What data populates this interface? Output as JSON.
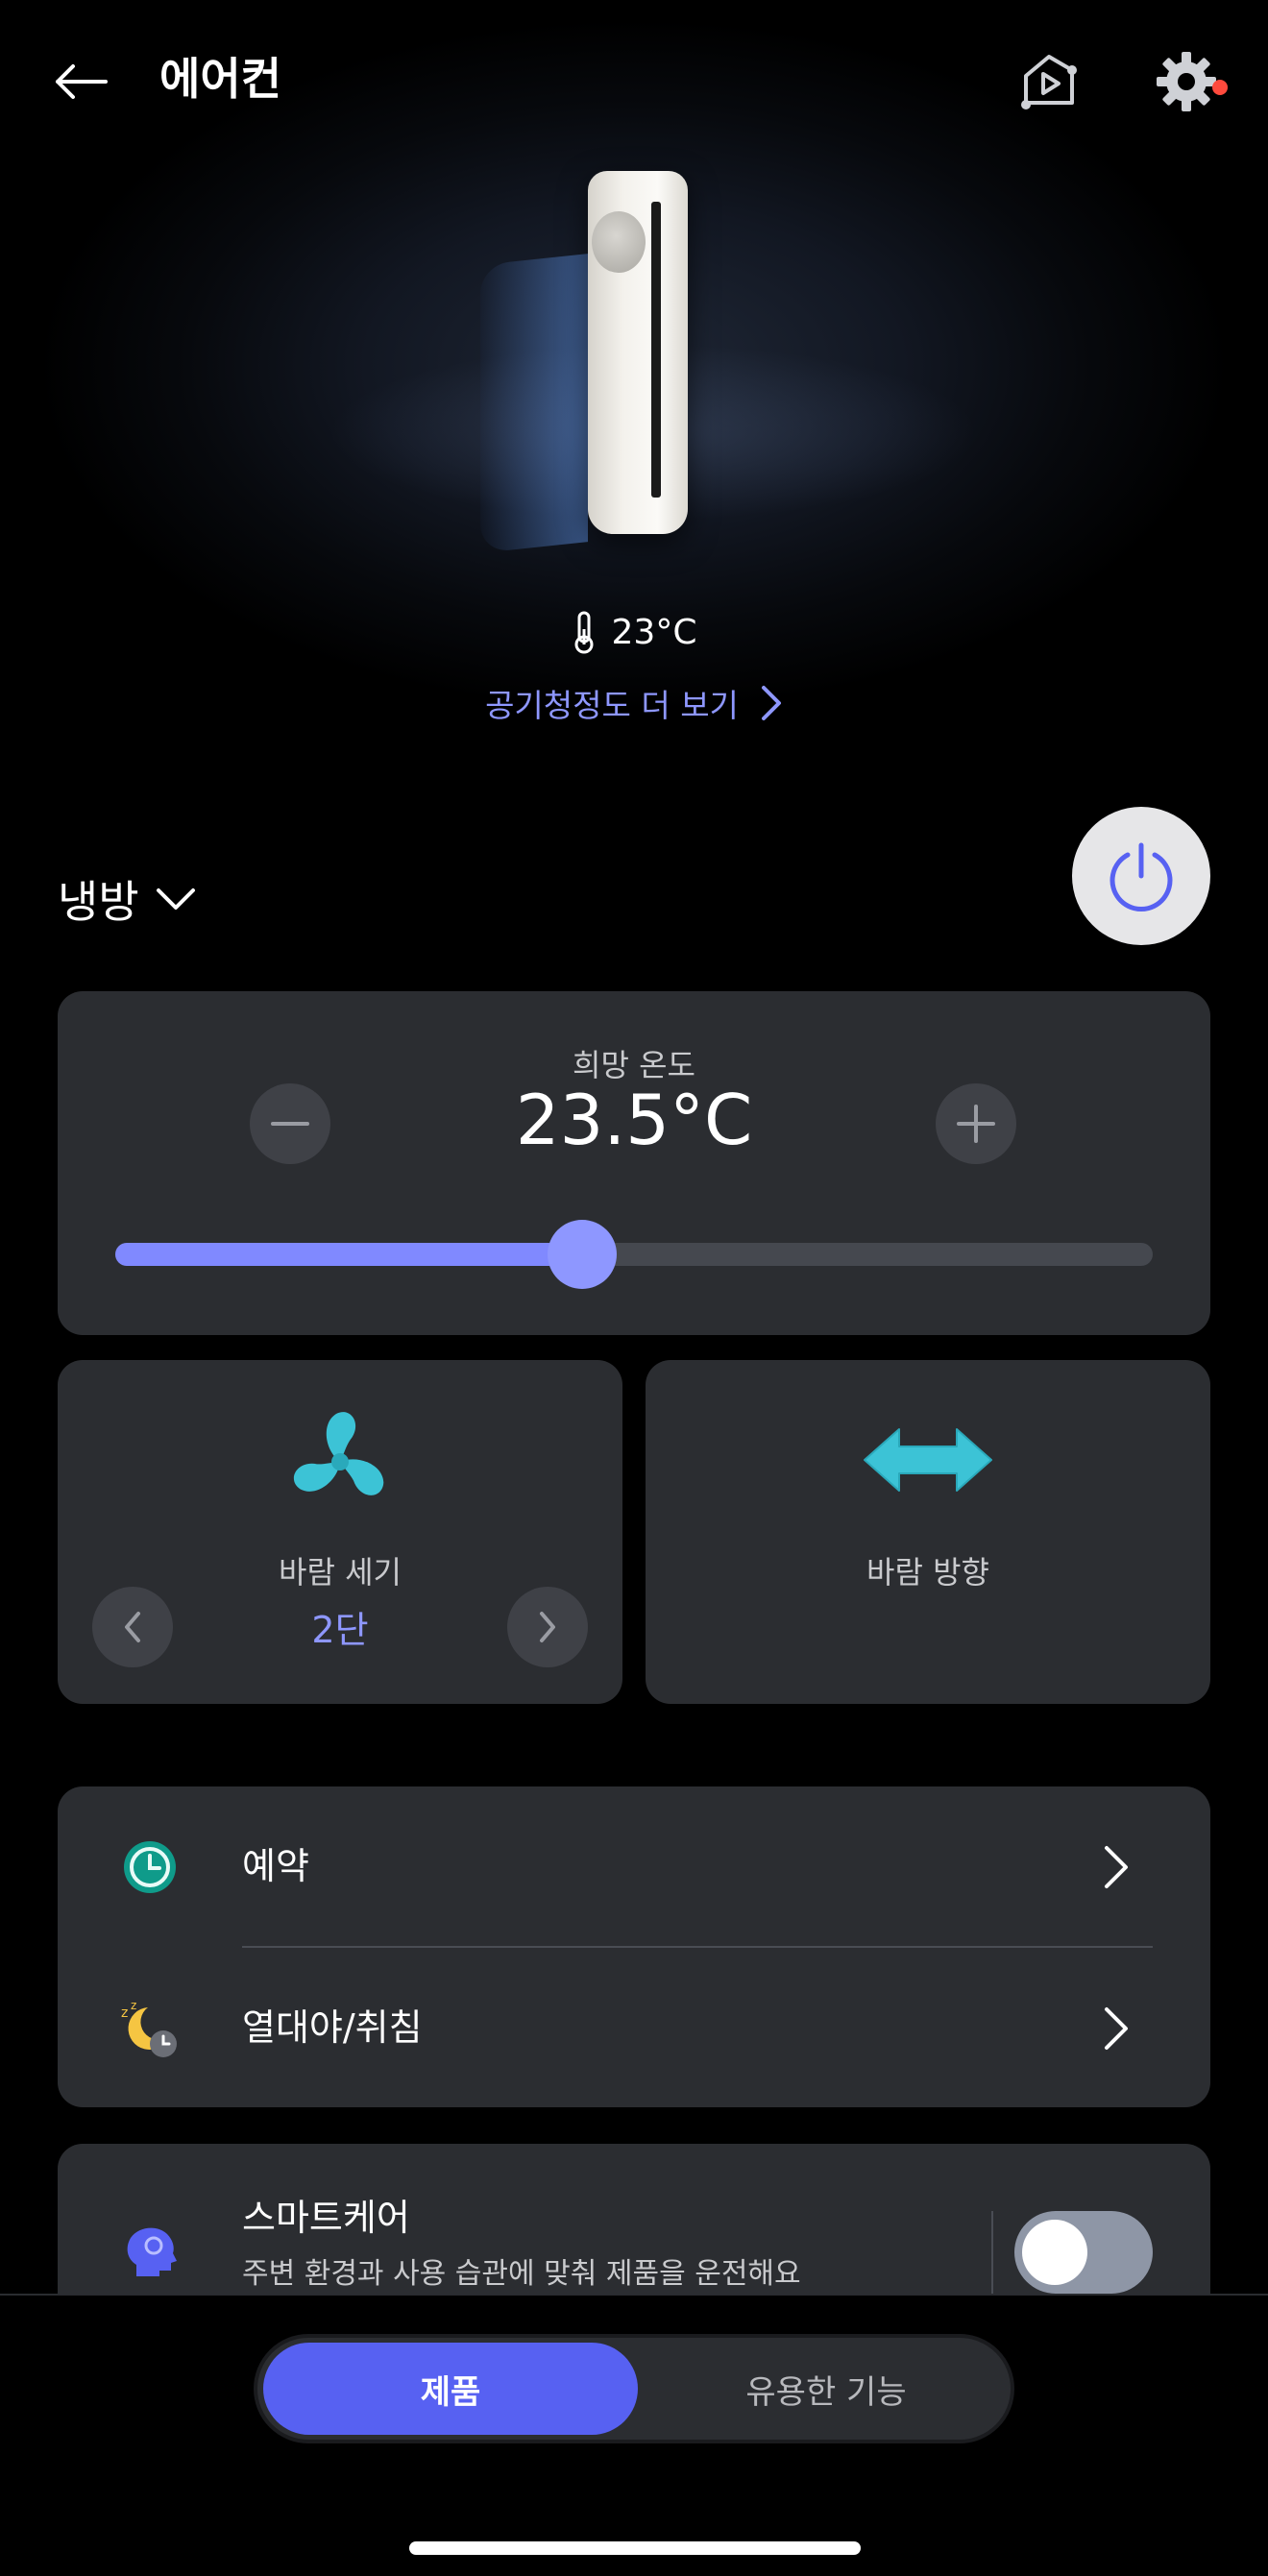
{
  "header": {
    "title": "에어컨",
    "back_icon": "back-arrow-icon",
    "media_icon": "play-video-icon",
    "settings_icon": "gear-icon",
    "notification_color": "#ff4a3d"
  },
  "hero": {
    "current_temperature": "23°C",
    "air_quality_link": "공기청정도 더 보기"
  },
  "mode": {
    "selected": "냉방",
    "power_icon": "power-icon",
    "power_on": true
  },
  "desired_temperature": {
    "label": "희망 온도",
    "value": "23.5°C",
    "slider_fraction": 0.45
  },
  "wind_strength": {
    "label": "바람 세기",
    "value": "2단"
  },
  "wind_direction": {
    "label": "바람 방향"
  },
  "menu": {
    "items": [
      {
        "label": "예약",
        "icon": "clock-icon"
      },
      {
        "label": "열대야/취침",
        "icon": "sleep-moon-icon"
      }
    ]
  },
  "smart_care": {
    "title": "스마트케어",
    "description": "주변 환경과 사용 습관에 맞춰 제품을 운전해요",
    "enabled": false
  },
  "bottom_tabs": {
    "active": "제품",
    "other": "유용한 기능"
  },
  "colors": {
    "accent": "#8e97ff",
    "tab_active": "#5761f2",
    "card": "#2b2d31",
    "teal": "#3cc3d6"
  }
}
